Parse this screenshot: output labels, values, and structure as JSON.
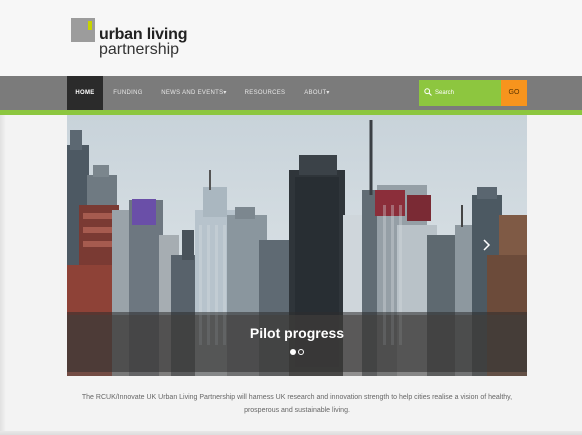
{
  "logo": {
    "line1": "urban living",
    "line2": "partnership",
    "accent_color": "#c8d400"
  },
  "nav": {
    "items": [
      {
        "label": "HOME",
        "active": true
      },
      {
        "label": "FUNDING",
        "active": false
      },
      {
        "label": "NEWS AND EVENTS▾",
        "active": false
      },
      {
        "label": "RESOURCES",
        "active": false
      },
      {
        "label": "ABOUT▾",
        "active": false
      }
    ],
    "bar_color": "#7b7b7b",
    "accent_color": "#8cc63f"
  },
  "search": {
    "placeholder": "Search",
    "icon": "search-icon",
    "button_label": "GO",
    "button_color": "#f7941d"
  },
  "hero": {
    "caption": "Pilot progress",
    "slide_count": 2,
    "active_slide": 1
  },
  "intro": {
    "text": "The RCUK/Innovate UK Urban Living Partnership will harness UK research and innovation strength to help cities realise a vision of healthy, prosperous and sustainable living."
  }
}
